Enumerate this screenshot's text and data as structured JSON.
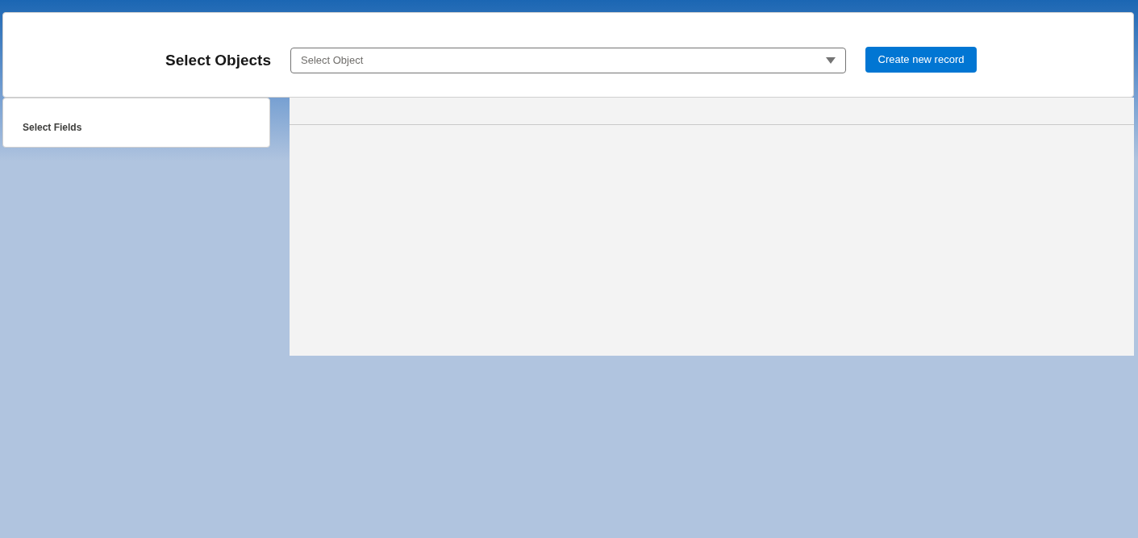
{
  "header": {
    "title": "Select Objects",
    "object_select": {
      "placeholder": "Select Object"
    },
    "create_button": "Create new record"
  },
  "fields_panel": {
    "title": "Select Fields"
  }
}
